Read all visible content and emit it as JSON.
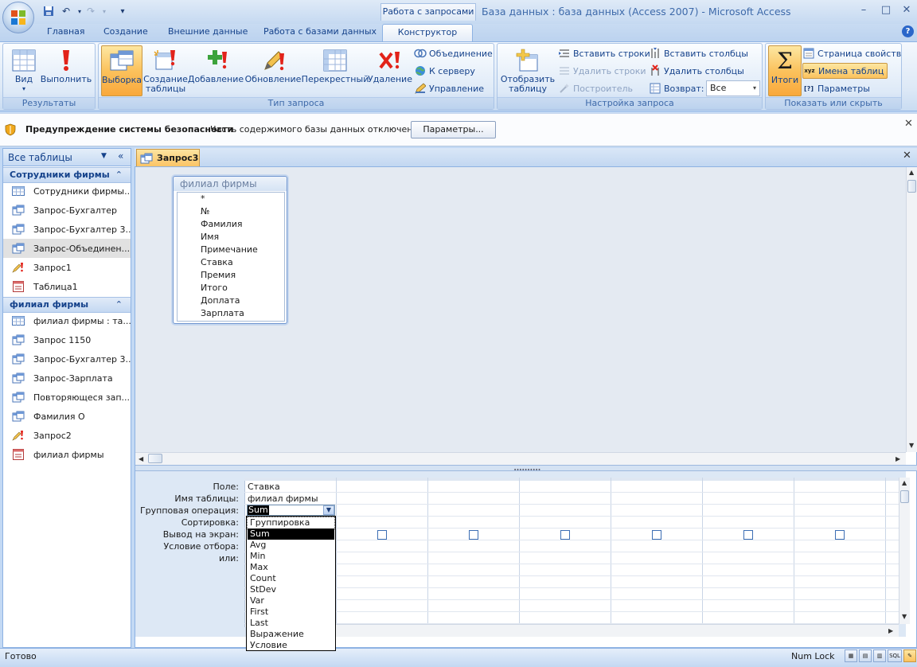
{
  "window": {
    "title": "База данных : база данных (Access 2007) - Microsoft Access",
    "context_tab_header": "Работа с запросами",
    "minimize": "–",
    "maximize": "□",
    "close": "✕"
  },
  "tabs": [
    "Главная",
    "Создание",
    "Внешние данные",
    "Работа с базами данных",
    "Конструктор"
  ],
  "ribbon": {
    "results": {
      "label": "Результаты",
      "view": "Вид",
      "run": "Выполнить"
    },
    "query_type": {
      "label": "Тип запроса",
      "select": "Выборка",
      "make_table_1": "Создание",
      "make_table_2": "таблицы",
      "append": "Добавление",
      "update": "Обновление",
      "crosstab": "Перекрестный",
      "delete": "Удаление",
      "union": "Объединение",
      "pass_through": "К серверу",
      "data_def": "Управление"
    },
    "query_setup": {
      "label": "Настройка запроса",
      "show_table_1": "Отобразить",
      "show_table_2": "таблицу",
      "insert_rows": "Вставить строки",
      "delete_rows": "Удалить строки",
      "builder": "Построитель",
      "insert_cols": "Вставить столбцы",
      "delete_cols": "Удалить столбцы",
      "return_label": "Возврат:",
      "return_value": "Все"
    },
    "show_hide": {
      "label": "Показать или скрыть",
      "totals": "Итоги",
      "property_sheet": "Страница свойств",
      "table_names": "Имена таблиц",
      "parameters": "Параметры"
    }
  },
  "security": {
    "title": "Предупреждение системы безопасности",
    "text": "Часть содержимого базы данных отключено",
    "button": "Параметры..."
  },
  "nav": {
    "title": "Все таблицы",
    "groups": [
      {
        "name": "Сотрудники фирмы",
        "items": [
          {
            "label": "Сотрудники фирмы...",
            "icon": "table"
          },
          {
            "label": "Запрос-Бухгалтер",
            "icon": "query"
          },
          {
            "label": "Запрос-Бухгалтер 3...",
            "icon": "query"
          },
          {
            "label": "Запрос-Объединен...",
            "icon": "query"
          },
          {
            "label": "Запрос1",
            "icon": "update"
          },
          {
            "label": "Таблица1",
            "icon": "form"
          }
        ]
      },
      {
        "name": "филиал фирмы",
        "items": [
          {
            "label": "филиал фирмы : та...",
            "icon": "table"
          },
          {
            "label": "Запрос 1150",
            "icon": "query"
          },
          {
            "label": "Запрос-Бухгалтер 3...",
            "icon": "query"
          },
          {
            "label": "Запрос-Зарплата",
            "icon": "query"
          },
          {
            "label": "Повторяющеся зап...",
            "icon": "query"
          },
          {
            "label": "Фамилия О",
            "icon": "query"
          },
          {
            "label": "Запрос2",
            "icon": "update"
          },
          {
            "label": "филиал фирмы",
            "icon": "form"
          }
        ]
      }
    ]
  },
  "document": {
    "tab": "Запрос3",
    "table_widget": {
      "title": "филиал фирмы",
      "fields": [
        "*",
        "№",
        "Фамилия",
        "Имя",
        "Примечание",
        "Ставка",
        "Премия",
        "Итого",
        "Доплата",
        "Зарплата"
      ]
    },
    "grid": {
      "row_labels": [
        "Поле:",
        "Имя таблицы:",
        "Групповая операция:",
        "Сортировка:",
        "Вывод на экран:",
        "Условие отбора:",
        "или:"
      ],
      "col1": {
        "field": "Ставка",
        "table": "филиал фирмы",
        "total": "Sum"
      },
      "dropdown_options": [
        "Группировка",
        "Sum",
        "Avg",
        "Min",
        "Max",
        "Count",
        "StDev",
        "Var",
        "First",
        "Last",
        "Выражение",
        "Условие"
      ],
      "dropdown_selected": "Sum"
    }
  },
  "status": {
    "text": "Готово",
    "numlock": "Num Lock",
    "sql": "SQL"
  }
}
